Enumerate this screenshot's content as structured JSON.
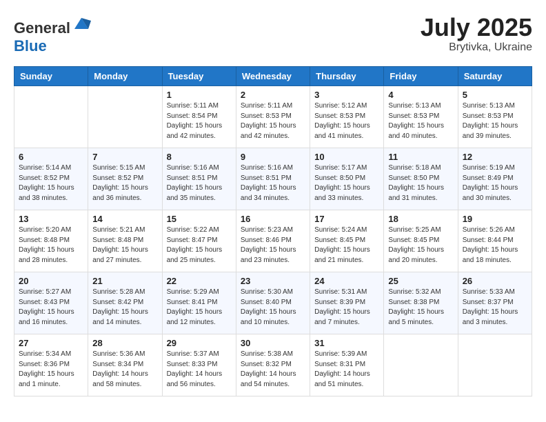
{
  "header": {
    "logo_general": "General",
    "logo_blue": "Blue",
    "title": "July 2025",
    "location": "Brytivka, Ukraine"
  },
  "weekdays": [
    "Sunday",
    "Monday",
    "Tuesday",
    "Wednesday",
    "Thursday",
    "Friday",
    "Saturday"
  ],
  "weeks": [
    [
      {
        "day": "",
        "detail": ""
      },
      {
        "day": "",
        "detail": ""
      },
      {
        "day": "1",
        "detail": "Sunrise: 5:11 AM\nSunset: 8:54 PM\nDaylight: 15 hours\nand 42 minutes."
      },
      {
        "day": "2",
        "detail": "Sunrise: 5:11 AM\nSunset: 8:53 PM\nDaylight: 15 hours\nand 42 minutes."
      },
      {
        "day": "3",
        "detail": "Sunrise: 5:12 AM\nSunset: 8:53 PM\nDaylight: 15 hours\nand 41 minutes."
      },
      {
        "day": "4",
        "detail": "Sunrise: 5:13 AM\nSunset: 8:53 PM\nDaylight: 15 hours\nand 40 minutes."
      },
      {
        "day": "5",
        "detail": "Sunrise: 5:13 AM\nSunset: 8:53 PM\nDaylight: 15 hours\nand 39 minutes."
      }
    ],
    [
      {
        "day": "6",
        "detail": "Sunrise: 5:14 AM\nSunset: 8:52 PM\nDaylight: 15 hours\nand 38 minutes."
      },
      {
        "day": "7",
        "detail": "Sunrise: 5:15 AM\nSunset: 8:52 PM\nDaylight: 15 hours\nand 36 minutes."
      },
      {
        "day": "8",
        "detail": "Sunrise: 5:16 AM\nSunset: 8:51 PM\nDaylight: 15 hours\nand 35 minutes."
      },
      {
        "day": "9",
        "detail": "Sunrise: 5:16 AM\nSunset: 8:51 PM\nDaylight: 15 hours\nand 34 minutes."
      },
      {
        "day": "10",
        "detail": "Sunrise: 5:17 AM\nSunset: 8:50 PM\nDaylight: 15 hours\nand 33 minutes."
      },
      {
        "day": "11",
        "detail": "Sunrise: 5:18 AM\nSunset: 8:50 PM\nDaylight: 15 hours\nand 31 minutes."
      },
      {
        "day": "12",
        "detail": "Sunrise: 5:19 AM\nSunset: 8:49 PM\nDaylight: 15 hours\nand 30 minutes."
      }
    ],
    [
      {
        "day": "13",
        "detail": "Sunrise: 5:20 AM\nSunset: 8:48 PM\nDaylight: 15 hours\nand 28 minutes."
      },
      {
        "day": "14",
        "detail": "Sunrise: 5:21 AM\nSunset: 8:48 PM\nDaylight: 15 hours\nand 27 minutes."
      },
      {
        "day": "15",
        "detail": "Sunrise: 5:22 AM\nSunset: 8:47 PM\nDaylight: 15 hours\nand 25 minutes."
      },
      {
        "day": "16",
        "detail": "Sunrise: 5:23 AM\nSunset: 8:46 PM\nDaylight: 15 hours\nand 23 minutes."
      },
      {
        "day": "17",
        "detail": "Sunrise: 5:24 AM\nSunset: 8:45 PM\nDaylight: 15 hours\nand 21 minutes."
      },
      {
        "day": "18",
        "detail": "Sunrise: 5:25 AM\nSunset: 8:45 PM\nDaylight: 15 hours\nand 20 minutes."
      },
      {
        "day": "19",
        "detail": "Sunrise: 5:26 AM\nSunset: 8:44 PM\nDaylight: 15 hours\nand 18 minutes."
      }
    ],
    [
      {
        "day": "20",
        "detail": "Sunrise: 5:27 AM\nSunset: 8:43 PM\nDaylight: 15 hours\nand 16 minutes."
      },
      {
        "day": "21",
        "detail": "Sunrise: 5:28 AM\nSunset: 8:42 PM\nDaylight: 15 hours\nand 14 minutes."
      },
      {
        "day": "22",
        "detail": "Sunrise: 5:29 AM\nSunset: 8:41 PM\nDaylight: 15 hours\nand 12 minutes."
      },
      {
        "day": "23",
        "detail": "Sunrise: 5:30 AM\nSunset: 8:40 PM\nDaylight: 15 hours\nand 10 minutes."
      },
      {
        "day": "24",
        "detail": "Sunrise: 5:31 AM\nSunset: 8:39 PM\nDaylight: 15 hours\nand 7 minutes."
      },
      {
        "day": "25",
        "detail": "Sunrise: 5:32 AM\nSunset: 8:38 PM\nDaylight: 15 hours\nand 5 minutes."
      },
      {
        "day": "26",
        "detail": "Sunrise: 5:33 AM\nSunset: 8:37 PM\nDaylight: 15 hours\nand 3 minutes."
      }
    ],
    [
      {
        "day": "27",
        "detail": "Sunrise: 5:34 AM\nSunset: 8:36 PM\nDaylight: 15 hours\nand 1 minute."
      },
      {
        "day": "28",
        "detail": "Sunrise: 5:36 AM\nSunset: 8:34 PM\nDaylight: 14 hours\nand 58 minutes."
      },
      {
        "day": "29",
        "detail": "Sunrise: 5:37 AM\nSunset: 8:33 PM\nDaylight: 14 hours\nand 56 minutes."
      },
      {
        "day": "30",
        "detail": "Sunrise: 5:38 AM\nSunset: 8:32 PM\nDaylight: 14 hours\nand 54 minutes."
      },
      {
        "day": "31",
        "detail": "Sunrise: 5:39 AM\nSunset: 8:31 PM\nDaylight: 14 hours\nand 51 minutes."
      },
      {
        "day": "",
        "detail": ""
      },
      {
        "day": "",
        "detail": ""
      }
    ]
  ]
}
